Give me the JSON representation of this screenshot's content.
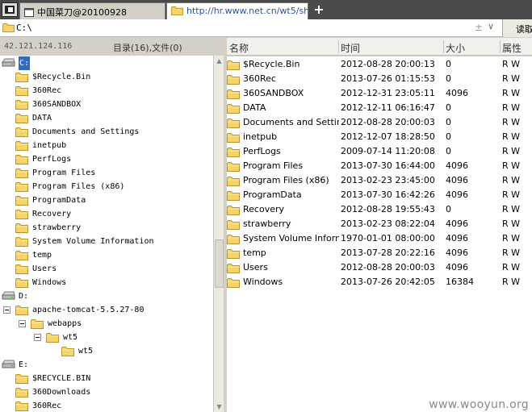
{
  "tabs": [
    {
      "label": "中国菜刀@20100928",
      "active": false
    },
    {
      "label": "http://hr.www.net.cn/wt5/sh...",
      "active": true
    }
  ],
  "new_tab_label": "+",
  "address": {
    "path": "C:\\",
    "plusminus": "±",
    "chevron": "∨",
    "read_button": "读取"
  },
  "left": {
    "ip": "42.121.124.116",
    "stats": "目录(16),文件(0)"
  },
  "tree": {
    "drive_c": "C:",
    "drive_c_items": [
      "$Recycle.Bin",
      "360Rec",
      "360SANDBOX",
      "DATA",
      "Documents and Settings",
      "inetpub",
      "PerfLogs",
      "Program Files",
      "Program Files (x86)",
      "ProgramData",
      "Recovery",
      "strawberry",
      "System Volume Information",
      "temp",
      "Users",
      "Windows"
    ],
    "drive_d": "D:",
    "tomcat": "apache-tomcat-5.5.27-80",
    "webapps": "webapps",
    "wt5_parent": "wt5",
    "wt5_child": "wt5",
    "drive_e": "E:",
    "drive_e_items": [
      "$RECYCLE.BIN",
      "360Downloads",
      "360Rec"
    ]
  },
  "columns": {
    "name": "名称",
    "time": "时间",
    "size": "大小",
    "attr": "属性"
  },
  "files": [
    {
      "name": "$Recycle.Bin",
      "time": "2012-08-28 20:00:13",
      "size": "0",
      "attr": "R W"
    },
    {
      "name": "360Rec",
      "time": "2013-07-26 01:15:53",
      "size": "0",
      "attr": "R W"
    },
    {
      "name": "360SANDBOX",
      "time": "2012-12-31 23:05:11",
      "size": "4096",
      "attr": "R W"
    },
    {
      "name": "DATA",
      "time": "2012-12-11 06:16:47",
      "size": "0",
      "attr": "R W"
    },
    {
      "name": "Documents and Settings",
      "time": "2012-08-28 20:00:03",
      "size": "0",
      "attr": "R W"
    },
    {
      "name": "inetpub",
      "time": "2012-12-07 18:28:50",
      "size": "0",
      "attr": "R W"
    },
    {
      "name": "PerfLogs",
      "time": "2009-07-14 11:20:08",
      "size": "0",
      "attr": "R W"
    },
    {
      "name": "Program Files",
      "time": "2013-07-30 16:44:00",
      "size": "4096",
      "attr": "R W"
    },
    {
      "name": "Program Files (x86)",
      "time": "2013-02-23 23:45:00",
      "size": "4096",
      "attr": "R W"
    },
    {
      "name": "ProgramData",
      "time": "2013-07-30 16:42:26",
      "size": "4096",
      "attr": "R W"
    },
    {
      "name": "Recovery",
      "time": "2012-08-28 19:55:43",
      "size": "0",
      "attr": "R W"
    },
    {
      "name": "strawberry",
      "time": "2013-02-23 08:22:04",
      "size": "4096",
      "attr": "R W"
    },
    {
      "name": "System Volume Inform...",
      "time": "1970-01-01 08:00:00",
      "size": "4096",
      "attr": "R W"
    },
    {
      "name": "temp",
      "time": "2013-07-28 20:22:16",
      "size": "4096",
      "attr": "R W"
    },
    {
      "name": "Users",
      "time": "2012-08-28 20:00:03",
      "size": "4096",
      "attr": "R W"
    },
    {
      "name": "Windows",
      "time": "2013-07-26 20:42:05",
      "size": "16384",
      "attr": "R W"
    }
  ],
  "watermark": "www.wooyun.org",
  "colors": {
    "selection": "#316ac5",
    "link_tab": "#2b52a8",
    "folder": "#f5d56a"
  }
}
